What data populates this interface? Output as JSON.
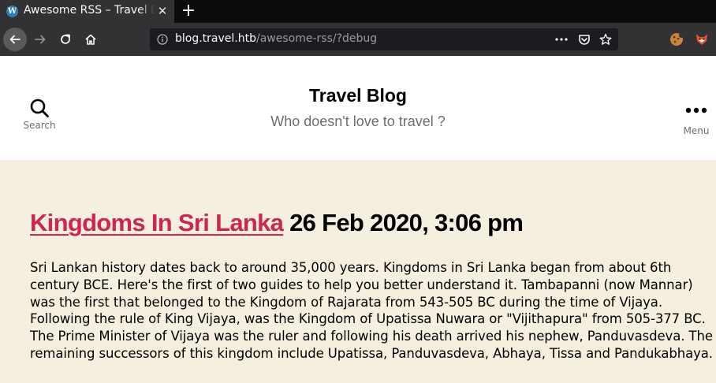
{
  "browser": {
    "tab": {
      "title": "Awesome RSS – Travel Blog",
      "favicon": "wordpress-icon"
    },
    "url": {
      "host": "blog.travel.htb",
      "path": "/awesome-rss/?debug"
    }
  },
  "site": {
    "title": "Travel Blog",
    "description": "Who doesn't love to travel ?",
    "search_label": "Search",
    "menu_label": "Menu"
  },
  "post": {
    "title": "Kingdoms In Sri Lanka",
    "date": "26 Feb 2020, 3:06 pm",
    "body": "Sri Lankan history dates back to around 35,000 years. Kingdoms in Sri Lanka began from about 6th century BCE. Here's the first of two guides to help you better understand it. Tambapanni (now Mannar) was the first that belonged to the Kingdom of Rajarata from 543-505 BC during the time of Vijaya. Following the rule of King Vijaya, was the Kingdom of Upatissa Nuwara or \"Vijithapura\" from 505-377 BC. The Prime Minister of Vijaya was the ruler and following his death arrived his nephew, Panduvasdeva. The remaining successors of this kingdom include Upatissa, Panduvasdeva, Abhaya, Tissa and Pandukabhaya."
  },
  "colors": {
    "link": "#cd2653",
    "content_bg": "#f5efe0",
    "header_bg": "#ffffff",
    "browser_chrome": "#323234"
  }
}
